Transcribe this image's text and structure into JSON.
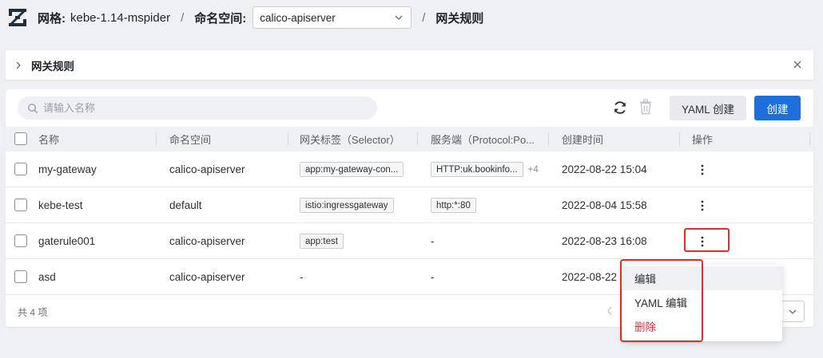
{
  "breadcrumb": {
    "mesh_label": "网格:",
    "mesh_name": "kebe-1.14-mspider",
    "sep1": "/",
    "namespace_label": "命名空间:",
    "namespace_value": "calico-apiserver",
    "sep2": "/",
    "page": "网关规则"
  },
  "panel": {
    "title": "网关规则"
  },
  "toolbar": {
    "search_placeholder": "请输入名称",
    "yaml_button": "YAML 创建",
    "create_button": "创建"
  },
  "table": {
    "columns": [
      "名称",
      "命名空间",
      "网关标签（Selector）",
      "服务端（Protocol:Po...",
      "创建时间",
      "操作"
    ],
    "rows": [
      {
        "name": "my-gateway",
        "namespace": "calico-apiserver",
        "selector": "app:my-gateway-con...",
        "server": "HTTP:uk.bookinfo...",
        "server_more": "+4",
        "created": "2022-08-22 15:04"
      },
      {
        "name": "kebe-test",
        "namespace": "default",
        "selector": "istio:ingressgateway",
        "server": "http:*:80",
        "server_more": "",
        "created": "2022-08-04 15:58"
      },
      {
        "name": "gaterule001",
        "namespace": "calico-apiserver",
        "selector": "app:test",
        "server": "-",
        "server_more": "",
        "created": "2022-08-23 16:08"
      },
      {
        "name": "asd",
        "namespace": "calico-apiserver",
        "selector": "-",
        "server": "-",
        "server_more": "",
        "created": "2022-08-22"
      }
    ]
  },
  "footer": {
    "count": "共 4 项"
  },
  "context_menu": {
    "items": [
      {
        "label": "编辑",
        "style": "active"
      },
      {
        "label": "YAML 编辑",
        "style": "normal"
      },
      {
        "label": "删除",
        "style": "danger"
      }
    ]
  },
  "colors": {
    "primary": "#1e6fd9",
    "danger": "#d9343f",
    "highlight": "#e22d2d",
    "page_bg": "#eef0f4"
  }
}
